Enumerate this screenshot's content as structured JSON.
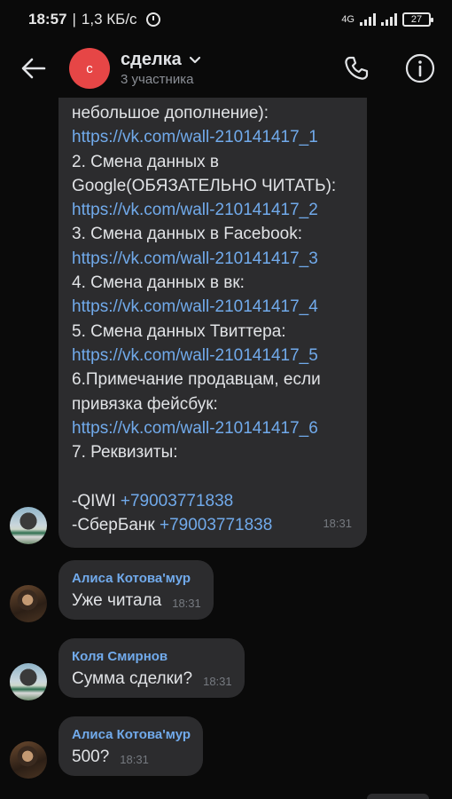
{
  "status_bar": {
    "time": "18:57",
    "separator": "|",
    "speed": "1,3 КБ/с",
    "network": "4G",
    "battery": "27"
  },
  "header": {
    "avatar_letter": "с",
    "title": "сделка",
    "subtitle": "3 участника"
  },
  "pinned_message": {
    "lines": [
      {
        "text": "небольшое дополнение):",
        "type": "text"
      },
      {
        "text": "https://vk.com/wall-210141417_1",
        "type": "link"
      },
      {
        "text": "2. Смена данных в",
        "type": "text"
      },
      {
        "text": "Google(ОБЯЗАТЕЛЬНО ЧИТАТЬ):",
        "type": "text"
      },
      {
        "text": "https://vk.com/wall-210141417_2",
        "type": "link"
      },
      {
        "text": "3. Смена данных в Facebook:",
        "type": "text"
      },
      {
        "text": "https://vk.com/wall-210141417_3",
        "type": "link"
      },
      {
        "text": "4. Смена данных в вк:",
        "type": "text"
      },
      {
        "text": "https://vk.com/wall-210141417_4",
        "type": "link"
      },
      {
        "text": "5. Смена данных Твиттера:",
        "type": "text"
      },
      {
        "text": "https://vk.com/wall-210141417_5",
        "type": "link"
      },
      {
        "text": "6.Примечание продавцам, если",
        "type": "text"
      },
      {
        "text": "привязка фейсбук:",
        "type": "text"
      },
      {
        "text": "https://vk.com/wall-210141417_6",
        "type": "link"
      },
      {
        "text": "7. Реквизиты:",
        "type": "text"
      },
      {
        "text": "",
        "type": "blank"
      }
    ],
    "qiwi_label": "-QIWI ",
    "qiwi_number": "+79003771838",
    "sber_label": "-СберБанк ",
    "sber_number": "+79003771838",
    "time": "18:31"
  },
  "messages": [
    {
      "author": "Алиса Котова'мур",
      "text": "Уже читала",
      "time": "18:31"
    },
    {
      "author": "Коля Смирнов",
      "text": "Сумма сделки?",
      "time": "18:31"
    },
    {
      "author": "Алиса Котова'мур",
      "text": "500?",
      "time": "18:31"
    }
  ],
  "colors": {
    "background": "#0a0a0a",
    "bubble": "#2c2c2e",
    "link": "#71aaeb",
    "chat_avatar": "#e64646"
  },
  "icons": [
    "back-arrow-icon",
    "chevron-down-icon",
    "phone-icon",
    "info-icon",
    "alarm-icon",
    "signal-icon",
    "battery-icon"
  ]
}
